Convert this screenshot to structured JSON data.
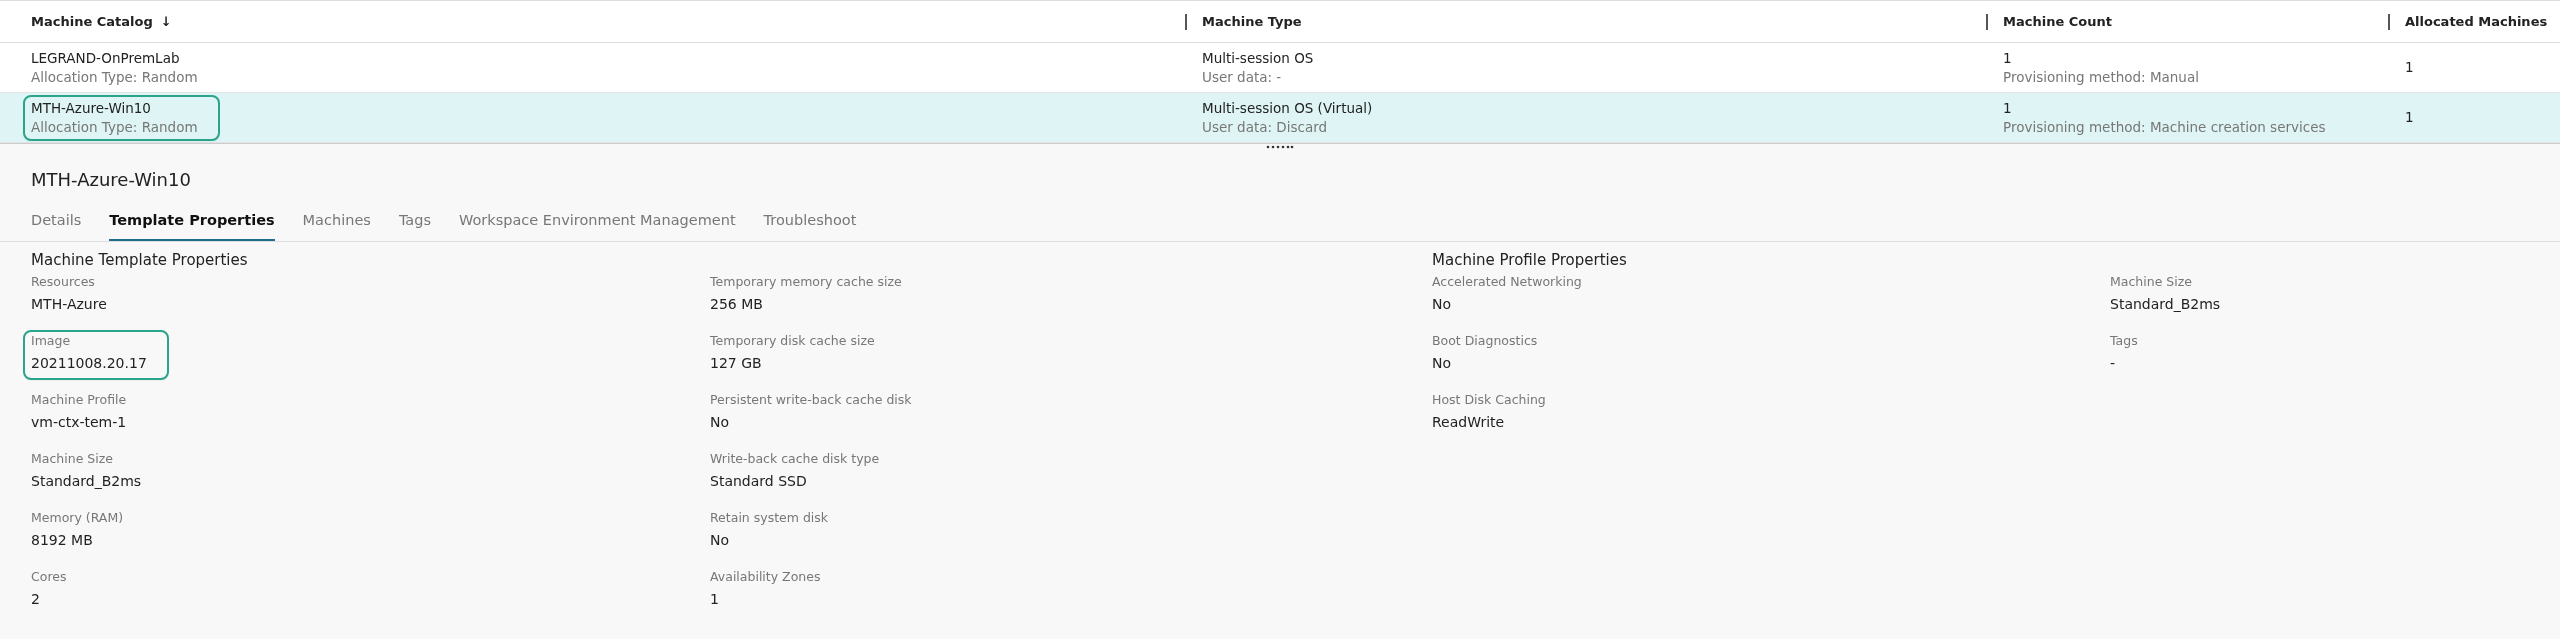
{
  "table": {
    "columns": [
      {
        "label": "Machine Catalog",
        "sort_indicator": "↓"
      },
      {
        "label": "Machine Type"
      },
      {
        "label": "Machine Count"
      },
      {
        "label": "Allocated Machines"
      }
    ],
    "rows": [
      {
        "selected": false,
        "highlighted": false,
        "cells": [
          {
            "main": "LEGRAND-OnPremLab",
            "sub": "Allocation Type: Random"
          },
          {
            "main": "Multi-session OS",
            "sub": "User data: -"
          },
          {
            "main": "1",
            "sub": "Provisioning method: Manual"
          },
          {
            "main": "1"
          }
        ]
      },
      {
        "selected": true,
        "highlighted": true,
        "cells": [
          {
            "main": "MTH-Azure-Win10",
            "sub": "Allocation Type: Random"
          },
          {
            "main": "Multi-session OS (Virtual)",
            "sub": "User data: Discard"
          },
          {
            "main": "1",
            "sub": "Provisioning method: Machine creation services"
          },
          {
            "main": "1"
          }
        ]
      }
    ]
  },
  "details": {
    "title": "MTH-Azure-Win10",
    "tabs": [
      {
        "label": "Details",
        "selected": false
      },
      {
        "label": "Template Properties",
        "selected": true
      },
      {
        "label": "Machines",
        "selected": false
      },
      {
        "label": "Tags",
        "selected": false
      },
      {
        "label": "Workspace Environment Management",
        "selected": false
      },
      {
        "label": "Troubleshoot",
        "selected": false
      }
    ],
    "sections": [
      {
        "title": "Machine Template Properties",
        "columns": [
          [
            {
              "label": "Resources",
              "value": "MTH-Azure",
              "highlighted": false
            },
            {
              "label": "Image",
              "value": "20211008.20.17",
              "highlighted": true
            },
            {
              "label": "Machine Profile",
              "value": "vm-ctx-tem-1",
              "highlighted": false
            },
            {
              "label": "Machine Size",
              "value": "Standard_B2ms",
              "highlighted": false
            },
            {
              "label": "Memory (RAM)",
              "value": "8192 MB",
              "highlighted": false
            },
            {
              "label": "Cores",
              "value": "2",
              "highlighted": false
            }
          ],
          [
            {
              "label": "Temporary memory cache size",
              "value": "256 MB",
              "highlighted": false
            },
            {
              "label": "Temporary disk cache size",
              "value": "127 GB",
              "highlighted": false
            },
            {
              "label": "Persistent write-back cache disk",
              "value": "No",
              "highlighted": false
            },
            {
              "label": "Write-back cache disk type",
              "value": "Standard SSD",
              "highlighted": false
            },
            {
              "label": "Retain system disk",
              "value": "No",
              "highlighted": false
            },
            {
              "label": "Availability Zones",
              "value": "1",
              "highlighted": false
            }
          ]
        ]
      },
      {
        "title": "Machine Profile Properties",
        "columns": [
          [
            {
              "label": "Accelerated Networking",
              "value": "No",
              "highlighted": false
            },
            {
              "label": "Boot Diagnostics",
              "value": "No",
              "highlighted": false
            },
            {
              "label": "Host Disk Caching",
              "value": "ReadWrite",
              "highlighted": false
            }
          ],
          [
            {
              "label": "Machine Size",
              "value": "Standard_B2ms",
              "highlighted": false
            },
            {
              "label": "Tags",
              "value": "-",
              "highlighted": false
            }
          ]
        ]
      }
    ]
  }
}
